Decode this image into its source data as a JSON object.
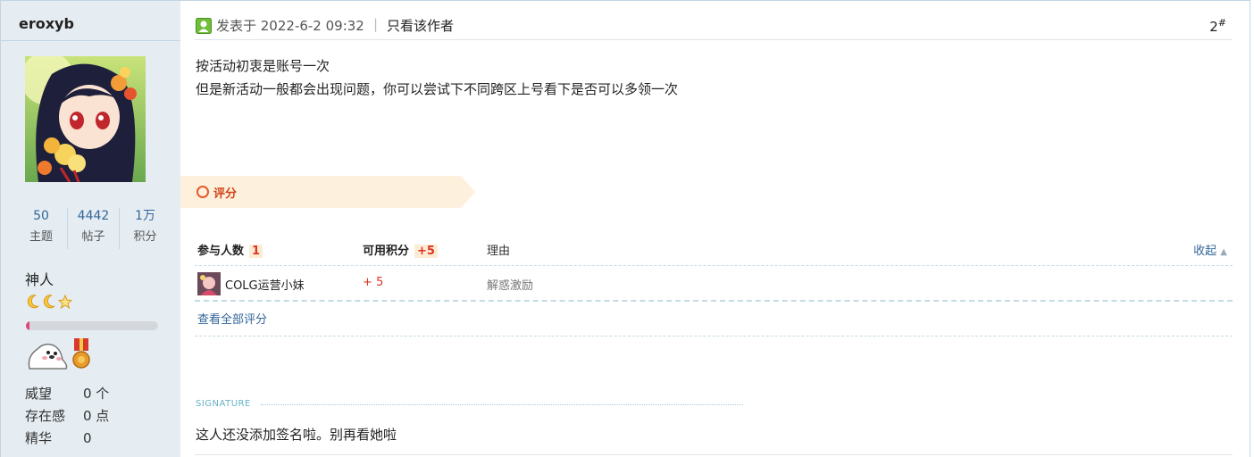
{
  "user": {
    "name": "eroxyb",
    "rank_title": "神人",
    "stats": [
      {
        "value": "50",
        "label": "主题"
      },
      {
        "value": "4442",
        "label": "帖子"
      },
      {
        "value": "1万",
        "label": "积分"
      }
    ],
    "progress_fraction": 0.03,
    "info": [
      {
        "key": "威望",
        "value": "0 个"
      },
      {
        "key": "存在感",
        "value": "0 点"
      },
      {
        "key": "精华",
        "value": "0"
      }
    ],
    "star_icons": [
      "moon-icon",
      "moon-icon",
      "star-icon"
    ],
    "medal_icons": [
      "seal-medal-icon",
      "ribbon-medal-icon"
    ]
  },
  "post": {
    "posted_at": "发表于 2022-6-2 09:32",
    "separator": "|",
    "author_only": "只看该作者",
    "floor_number": "2",
    "floor_mark": "#",
    "content_lines": [
      "按活动初衷是账号一次",
      "但是新活动一般都会出现问题，你可以尝试下不同跨区上号看下是否可以多领一次"
    ]
  },
  "rating": {
    "tag_label": "评分",
    "col_participants": "参与人数",
    "participants_count": "1",
    "col_points": "可用积分",
    "points_total": "+5",
    "col_reason": "理由",
    "collapse_label": "收起",
    "rows": [
      {
        "user": "COLG运营小妹",
        "score": "+ 5",
        "reason": "解惑激励"
      }
    ],
    "view_all": "查看全部评分"
  },
  "signature": {
    "label": "SIGNATURE",
    "text": "这人还没添加签名啦。别再看她啦"
  },
  "colors": {
    "sidebar_bg": "#e5edf2",
    "border": "#c2d5e3",
    "link": "#336699",
    "accent_red": "#dd3322",
    "rating_tag_bg": "#fdf0dd"
  }
}
